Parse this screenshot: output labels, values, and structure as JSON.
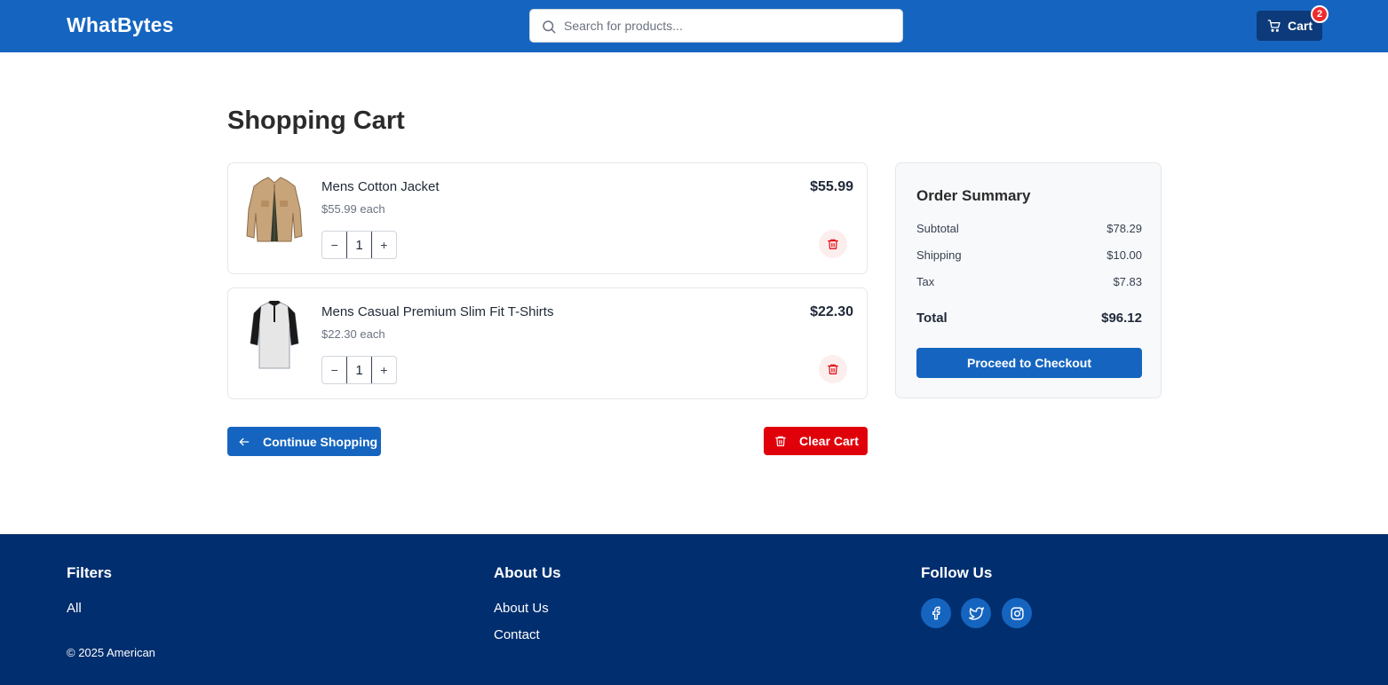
{
  "header": {
    "logo": "WhatBytes",
    "search_placeholder": "Search for products...",
    "cart_label": "Cart",
    "cart_count": "2",
    "bg_color": "#1565c0"
  },
  "page": {
    "title": "Shopping Cart"
  },
  "cart": {
    "items": [
      {
        "name": "Mens Cotton Jacket",
        "each": "$55.99 each",
        "price": "$55.99",
        "quantity": "1",
        "image_icon": "jacket-image"
      },
      {
        "name": "Mens Casual Premium Slim Fit T-Shirts",
        "each": "$22.30 each",
        "price": "$22.30",
        "quantity": "1",
        "image_icon": "tshirt-image"
      }
    ],
    "qty_minus": "−",
    "qty_plus": "+",
    "continue_label": "Continue Shopping",
    "clear_label": "Clear Cart"
  },
  "summary": {
    "title": "Order Summary",
    "subtotal_label": "Subtotal",
    "subtotal_value": "$78.29",
    "shipping_label": "Shipping",
    "shipping_value": "$10.00",
    "tax_label": "Tax",
    "tax_value": "$7.83",
    "total_label": "Total",
    "total_value": "$96.12",
    "checkout_label": "Proceed to Checkout"
  },
  "footer": {
    "filters_heading": "Filters",
    "filters_all": "All",
    "copyright": "© 2025 American",
    "about_heading": "About Us",
    "about_link": "About Us",
    "contact_link": "Contact",
    "follow_heading": "Follow Us",
    "social_icons": [
      "facebook-icon",
      "twitter-icon",
      "instagram-icon"
    ],
    "bg_color": "#002e6e"
  },
  "colors": {
    "primary": "#1565c0",
    "danger": "#e0000a",
    "footer": "#002e6e"
  }
}
